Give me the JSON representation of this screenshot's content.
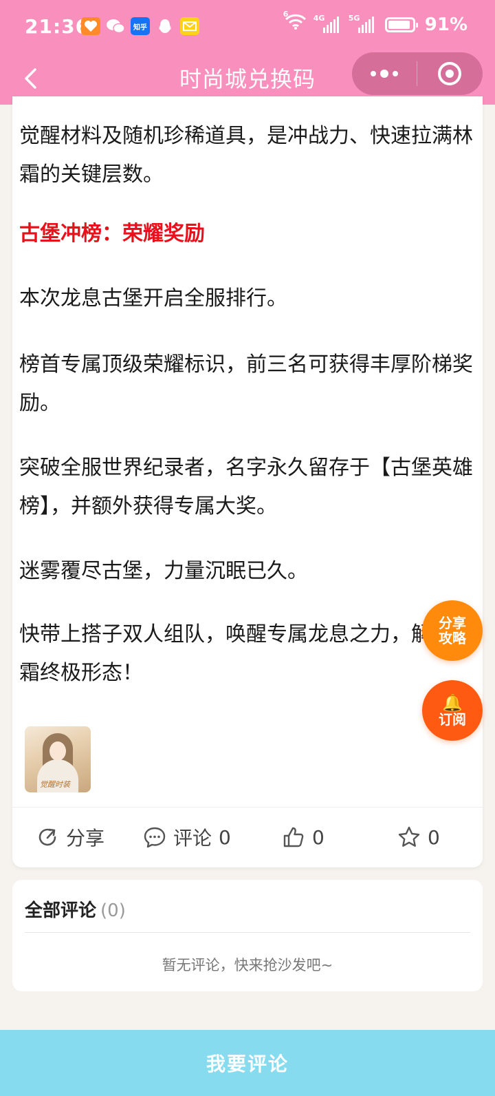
{
  "status_bar": {
    "time": "21:36",
    "battery_percent": "91%",
    "battery_level": 0.91,
    "signal_labels": [
      "6",
      "4G",
      "5G"
    ],
    "app_icons": [
      "heart-app-icon",
      "wechat-icon",
      "zhihu-icon",
      "qq-icon",
      "mail-icon"
    ],
    "zhihu_label": "知乎"
  },
  "nav": {
    "title": "时尚城兑换码",
    "back_icon": "chevron-left-icon",
    "more_icon": "more-dots-icon",
    "close_icon": "target-close-icon"
  },
  "article": {
    "paragraphs": [
      {
        "text": "觉醒材料及随机珍稀道具，是冲战力、快速拉满林霜的关键层数。",
        "style": "normal"
      },
      {
        "text": "古堡冲榜：荣耀奖励",
        "style": "heading"
      },
      {
        "text": "本次龙息古堡开启全服排行。",
        "style": "normal"
      },
      {
        "text": "榜首专属顶级荣耀标识，前三名可获得丰厚阶梯奖励。",
        "style": "normal"
      },
      {
        "text": "突破全服世界纪录者，名字永久留存于【古堡英雄榜】，并额外获得专属大奖。",
        "style": "normal"
      },
      {
        "text": "迷雾覆尽古堡，力量沉眠已久。",
        "style": "normal"
      },
      {
        "text": "快带上搭子双人组队，唤醒专属龙息之力，解锁林霜终极形态！",
        "style": "normal"
      }
    ],
    "thumbnail_caption": "觉醒时装"
  },
  "actions": {
    "share": {
      "label": "分享",
      "icon": "share-icon"
    },
    "comment": {
      "label": "评论",
      "count": "0",
      "icon": "comment-icon"
    },
    "like": {
      "count": "0",
      "icon": "thumbs-up-icon"
    },
    "favorite": {
      "count": "0",
      "icon": "star-icon"
    }
  },
  "comments": {
    "title": "全部评论",
    "count": "(0)",
    "empty_text": "暂无评论，快来抢沙发吧~"
  },
  "floating": {
    "share_guide": [
      "分享",
      "攻略"
    ],
    "subscribe": "订阅",
    "subscribe_icon": "bell-icon"
  },
  "bottom": {
    "comment_button": "我要评论"
  },
  "colors": {
    "header": "#f98fbd",
    "heading_red": "#e8111b",
    "float_share": "#ff8a0b",
    "float_subscribe": "#ff5a12",
    "bottom_bar": "#86dbee"
  }
}
